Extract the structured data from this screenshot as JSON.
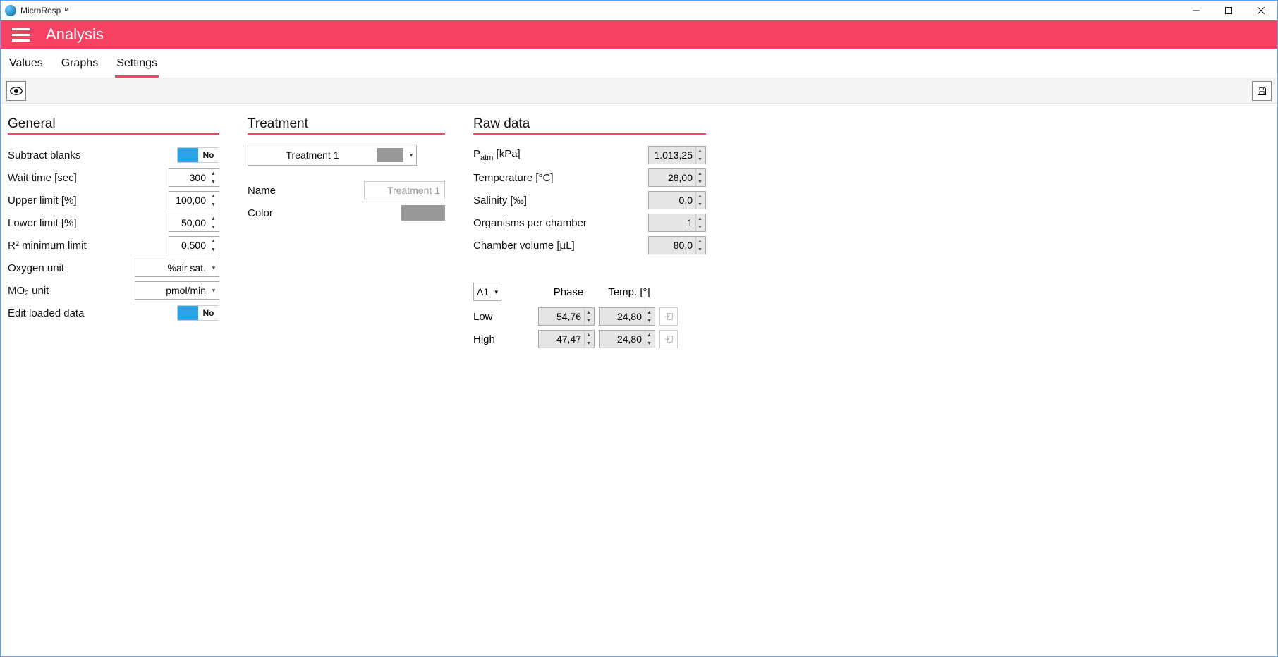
{
  "window": {
    "title": "MicroResp™"
  },
  "header": {
    "title": "Analysis"
  },
  "tabs": [
    "Values",
    "Graphs",
    "Settings"
  ],
  "activeTab": "Settings",
  "sections": {
    "general": {
      "title": "General",
      "subtractBlanks": {
        "label": "Subtract blanks",
        "value": "No"
      },
      "waitTime": {
        "label": "Wait time [sec]",
        "value": "300"
      },
      "upperLimit": {
        "label": "Upper limit [%]",
        "value": "100,00"
      },
      "lowerLimit": {
        "label": "Lower limit [%]",
        "value": "50,00"
      },
      "r2min": {
        "label": "R² minimum limit",
        "value": "0,500"
      },
      "oxygenUnit": {
        "label": "Oxygen unit",
        "value": "%air sat."
      },
      "mo2unit": {
        "label": "MO₂ unit",
        "value": "pmol/min"
      },
      "editLoaded": {
        "label": "Edit loaded data",
        "value": "No"
      }
    },
    "treatment": {
      "title": "Treatment",
      "selected": "Treatment 1",
      "nameLabel": "Name",
      "nameValue": "Treatment 1",
      "colorLabel": "Color"
    },
    "raw": {
      "title": "Raw data",
      "patm": {
        "label": "Pₐₜₘ [kPa]",
        "labelPrefix": "P",
        "labelSub": "atm",
        "labelSuffix": " [kPa]",
        "value": "1.013,25"
      },
      "temp": {
        "label": "Temperature [°C]",
        "value": "28,00"
      },
      "sal": {
        "label": "Salinity [‰]",
        "value": "0,0"
      },
      "org": {
        "label": "Organisms per chamber",
        "value": "1"
      },
      "cvol": {
        "label": "Chamber volume [µL]",
        "value": "80,0"
      },
      "well": "A1",
      "phaseHeader": "Phase",
      "tempHeader": "Temp. [°]",
      "low": {
        "label": "Low",
        "phase": "54,76",
        "temp": "24,80"
      },
      "high": {
        "label": "High",
        "phase": "47,47",
        "temp": "24,80"
      }
    }
  }
}
